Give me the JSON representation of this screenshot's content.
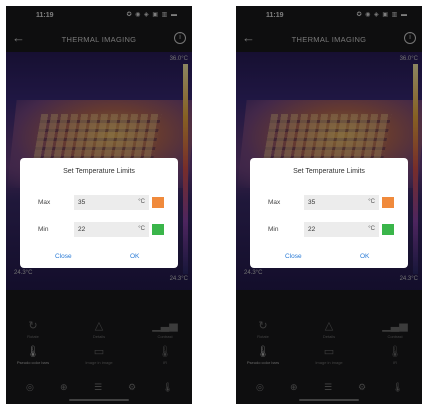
{
  "screens": [
    {
      "status": {
        "time": "11:19",
        "icons": "✪ ◉ ◈ ▣ ▥ ▬"
      },
      "app": {
        "back_icon": "←",
        "title": "THERMAL IMAGING",
        "info_icon": "i"
      },
      "image": {
        "max_temp": "36.0°C",
        "min_temp_left": "24.3°C",
        "min_temp_right": "24.3°C"
      },
      "dialog": {
        "title": "Set Temperature Limits",
        "max_label": "Max",
        "max_value": "35",
        "max_unit": "°C",
        "max_color": "#f08a3c",
        "min_label": "Min",
        "min_value": "22",
        "min_unit": "°C",
        "min_color": "#3ab54a",
        "close_label": "Close",
        "ok_label": "OK"
      },
      "tools": [
        {
          "label": "Rotate",
          "icon": "↻"
        },
        {
          "label": "Details",
          "icon": "△"
        },
        {
          "label": "Contrast",
          "icon": "▁▃▅"
        },
        {
          "label": "Pseudo color bars",
          "icon": "🌡"
        },
        {
          "label": "Image in image",
          "icon": "▭"
        },
        {
          "label": "IR",
          "icon": "🌡"
        }
      ],
      "nav_icons": [
        "◎",
        "⊕",
        "☰",
        "⚙",
        "🌡"
      ]
    },
    {
      "status": {
        "time": "11:19",
        "icons": "✪ ◉ ◈ ▣ ▥ ▬"
      },
      "app": {
        "back_icon": "←",
        "title": "THERMAL IMAGING",
        "info_icon": "i"
      },
      "image": {
        "max_temp": "36.0°C",
        "min_temp_left": "24.3°C",
        "min_temp_right": "24.3°C"
      },
      "dialog": {
        "title": "Set Temperature Limits",
        "max_label": "Max",
        "max_value": "35",
        "max_unit": "°C",
        "max_color": "#f08a3c",
        "min_label": "Min",
        "min_value": "22",
        "min_unit": "°C",
        "min_color": "#3ab54a",
        "close_label": "Close",
        "ok_label": "OK"
      },
      "tools": [
        {
          "label": "Rotate",
          "icon": "↻"
        },
        {
          "label": "Details",
          "icon": "△"
        },
        {
          "label": "Contrast",
          "icon": "▁▃▅"
        },
        {
          "label": "Pseudo color bars",
          "icon": "🌡"
        },
        {
          "label": "Image in image",
          "icon": "▭"
        },
        {
          "label": "IR",
          "icon": "🌡"
        }
      ],
      "nav_icons": [
        "◎",
        "⊕",
        "☰",
        "⚙",
        "🌡"
      ]
    }
  ]
}
